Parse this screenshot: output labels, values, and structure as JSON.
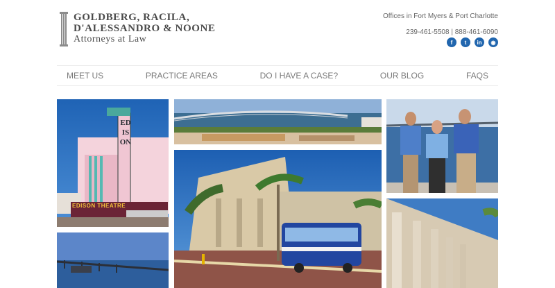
{
  "logo": {
    "line1": "GOLDBERG, RACILA,",
    "line2": "D'ALESSANDRO & NOONE",
    "line3": "Attorneys at Law"
  },
  "contact": {
    "offices": "Offices in Fort Myers & Port Charlotte",
    "phones": "239-461-5508 | 888-461-6090"
  },
  "social": [
    {
      "icon": "facebook-icon",
      "glyph": "f"
    },
    {
      "icon": "twitter-icon",
      "glyph": "t"
    },
    {
      "icon": "linkedin-icon",
      "glyph": "in"
    },
    {
      "icon": "rss-icon",
      "glyph": "◉"
    }
  ],
  "nav": [
    "MEET US",
    "PRACTICE AREAS",
    "DO I HAVE A CASE?",
    "OUR BLOG",
    "FAQS"
  ],
  "edison_sign": "EDISON",
  "marquee": "EDISON THEATRE",
  "colors": {
    "brand_blue": "#2166ae",
    "sky": "#2a70c0",
    "text": "#4a4a4a"
  }
}
